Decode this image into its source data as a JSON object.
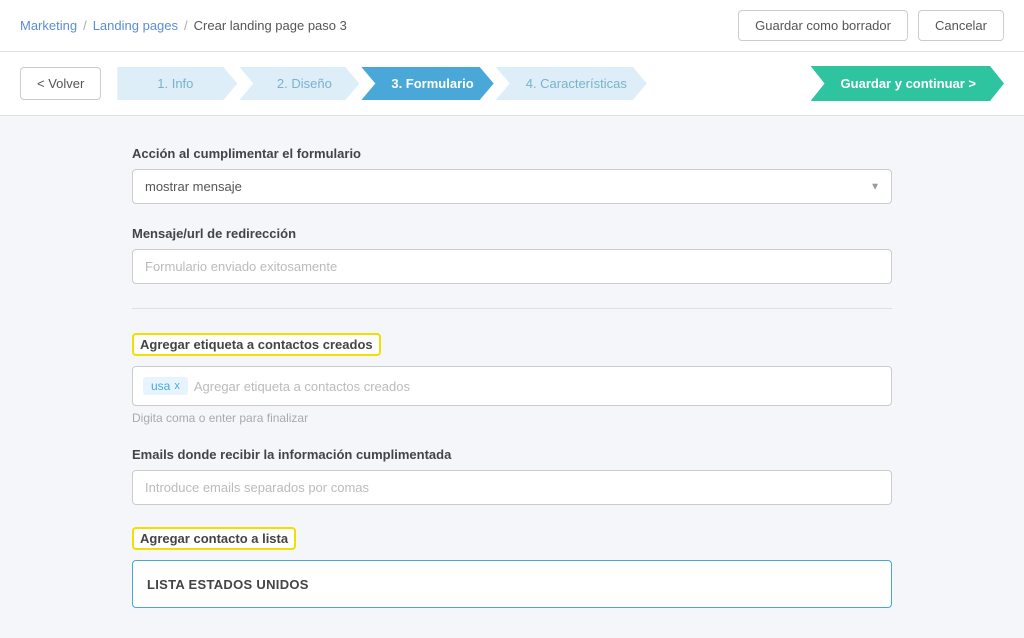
{
  "topNav": {
    "breadcrumb": {
      "marketing": "Marketing",
      "landingPages": "Landing pages",
      "current": "Crear landing page paso 3"
    },
    "buttons": {
      "draft": "Guardar como borrador",
      "cancel": "Cancelar"
    }
  },
  "stepsBar": {
    "backLabel": "< Volver",
    "steps": [
      {
        "id": "step-1",
        "label": "1. Info",
        "state": "inactive"
      },
      {
        "id": "step-2",
        "label": "2. Diseño",
        "state": "inactive"
      },
      {
        "id": "step-3",
        "label": "3. Formulario",
        "state": "active"
      },
      {
        "id": "step-4",
        "label": "4. Características",
        "state": "inactive"
      }
    ],
    "saveLabel": "Guardar y continuar >"
  },
  "form": {
    "actionLabel": "Acción al cumplimentar el formulario",
    "actionValue": "mostrar mensaje",
    "messageLabel": "Mensaje/url de redirección",
    "messagePlaceholder": "Formulario enviado exitosamente",
    "tagLabel": "Agregar etiqueta a contactos creados",
    "tagValue": "usa",
    "tagPlaceholder": "Agregar etiqueta a contactos creados",
    "tagHint": "Digita coma o enter para finalizar",
    "emailLabel": "Emails donde recibir la información cumplimentada",
    "emailPlaceholder": "Introduce emails separados por comas",
    "listLabel": "Agregar contacto a lista",
    "listValue": "LISTA ESTADOS UNIDOS"
  }
}
